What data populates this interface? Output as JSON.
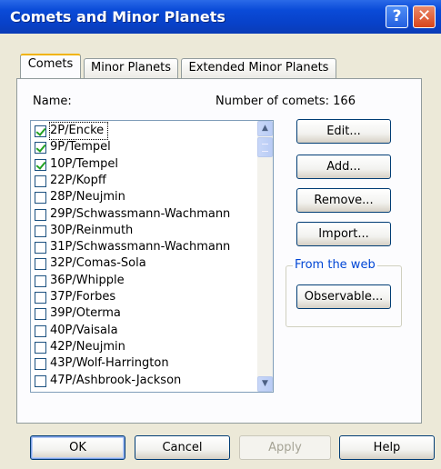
{
  "window": {
    "title": "Comets and Minor Planets",
    "help_glyph": "?",
    "close_glyph": "✕"
  },
  "tabs": [
    {
      "label": "Comets",
      "active": true
    },
    {
      "label": "Minor Planets",
      "active": false
    },
    {
      "label": "Extended Minor Planets",
      "active": false
    }
  ],
  "panel": {
    "name_label": "Name:",
    "count_label": "Number of comets: 166"
  },
  "comets": [
    {
      "name": "2P/Encke",
      "checked": true
    },
    {
      "name": "9P/Tempel",
      "checked": true
    },
    {
      "name": "10P/Tempel",
      "checked": true
    },
    {
      "name": "22P/Kopff",
      "checked": false
    },
    {
      "name": "28P/Neujmin",
      "checked": false
    },
    {
      "name": "29P/Schwassmann-Wachmann",
      "checked": false
    },
    {
      "name": "30P/Reinmuth",
      "checked": false
    },
    {
      "name": "31P/Schwassmann-Wachmann",
      "checked": false
    },
    {
      "name": "32P/Comas-Sola",
      "checked": false
    },
    {
      "name": "36P/Whipple",
      "checked": false
    },
    {
      "name": "37P/Forbes",
      "checked": false
    },
    {
      "name": "39P/Oterma",
      "checked": false
    },
    {
      "name": "40P/Vaisala",
      "checked": false
    },
    {
      "name": "42P/Neujmin",
      "checked": false
    },
    {
      "name": "43P/Wolf-Harrington",
      "checked": false
    },
    {
      "name": "47P/Ashbrook-Jackson",
      "checked": false
    }
  ],
  "actions": {
    "edit": "Edit...",
    "add": "Add...",
    "remove": "Remove...",
    "import": "Import..."
  },
  "web_group": {
    "label": "From the web",
    "observable": "Observable..."
  },
  "footer": {
    "ok": "OK",
    "cancel": "Cancel",
    "apply": "Apply",
    "help": "Help"
  }
}
